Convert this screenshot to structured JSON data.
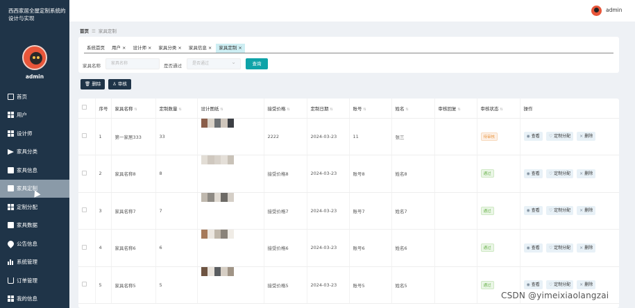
{
  "app": {
    "title": "西西家居全屋定制系统的设计与实现"
  },
  "sidebar": {
    "user": "admin",
    "items": [
      {
        "label": "首页",
        "icon": "home-icon"
      },
      {
        "label": "用户",
        "icon": "grid-icon"
      },
      {
        "label": "设计师",
        "icon": "grid-icon"
      },
      {
        "label": "家具分类",
        "icon": "send-icon"
      },
      {
        "label": "家具信息",
        "icon": "box-icon"
      },
      {
        "label": "家具定制",
        "icon": "box-icon",
        "active": true
      },
      {
        "label": "定制分配",
        "icon": "grid-icon"
      },
      {
        "label": "家具数据",
        "icon": "box-icon"
      },
      {
        "label": "公告信息",
        "icon": "pin-icon"
      },
      {
        "label": "系统管理",
        "icon": "bar-chart-icon"
      },
      {
        "label": "订单管理",
        "icon": "cart-icon"
      },
      {
        "label": "我的信息",
        "icon": "grid-icon"
      }
    ]
  },
  "topbar": {
    "user": "admin"
  },
  "breadcrumb": {
    "home": "首页",
    "sep": "☰",
    "current": "家具定制"
  },
  "tabs": [
    {
      "label": "系统首页",
      "closable": false
    },
    {
      "label": "用户",
      "closable": true
    },
    {
      "label": "设计师",
      "closable": true
    },
    {
      "label": "家具分类",
      "closable": true
    },
    {
      "label": "家具信息",
      "closable": true
    },
    {
      "label": "家具定制",
      "closable": true,
      "active": true
    }
  ],
  "filters": {
    "name_label": "家具名称",
    "name_placeholder": "家具名称",
    "approved_label": "是否通过",
    "approved_placeholder": "是否通过",
    "query_button": "查询"
  },
  "actions": {
    "delete": "删除",
    "review": "审核"
  },
  "table": {
    "headers": [
      "",
      "序号",
      "家具名称",
      "定制数量",
      "设计图纸",
      "接受价格",
      "定制日期",
      "账号",
      "姓名",
      "审核回复",
      "审核状态",
      "操作"
    ],
    "ops": {
      "view": "查看",
      "assign": "定制分配",
      "delete": "删除"
    },
    "rows": [
      {
        "index": "1",
        "name": "第一家居333",
        "qty": "33",
        "price": "2222",
        "date": "2024-03-23",
        "account": "11",
        "person": "张三",
        "reply": "",
        "status": "待审核",
        "status_type": "pending"
      },
      {
        "index": "2",
        "name": "家具名称8",
        "qty": "8",
        "price": "接受价格8",
        "date": "2024-03-23",
        "account": "账号8",
        "person": "姓名8",
        "reply": "",
        "status": "通过",
        "status_type": "ok"
      },
      {
        "index": "3",
        "name": "家具名称7",
        "qty": "7",
        "price": "接受价格7",
        "date": "2024-03-23",
        "account": "账号7",
        "person": "姓名7",
        "reply": "",
        "status": "通过",
        "status_type": "ok"
      },
      {
        "index": "4",
        "name": "家具名称6",
        "qty": "6",
        "price": "接受价格6",
        "date": "2024-03-23",
        "account": "账号6",
        "person": "姓名6",
        "reply": "",
        "status": "通过",
        "status_type": "ok"
      },
      {
        "index": "5",
        "name": "家具名称5",
        "qty": "5",
        "price": "接受价格5",
        "date": "2024-03-23",
        "account": "账号5",
        "person": "姓名5",
        "reply": "",
        "status": "通过",
        "status_type": "ok"
      }
    ]
  },
  "watermark": "CSDN @yimeixiaolangzai",
  "colors": {
    "sidebar": "#1f3448",
    "accent": "#0fa3a8",
    "active_tab": "#cdeef3"
  }
}
